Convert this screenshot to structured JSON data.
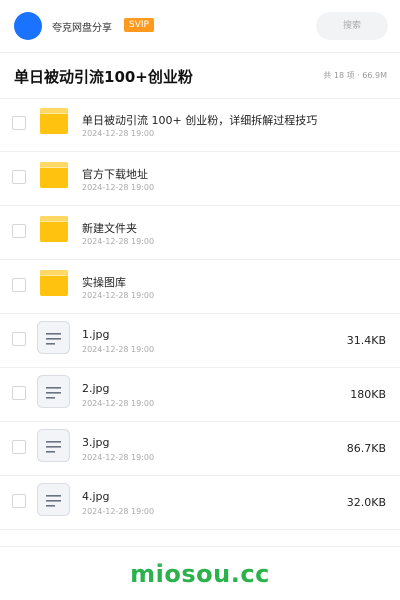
{
  "header": {
    "share_name": "夸克网盘分享",
    "badge": "SVIP",
    "search_placeholder": "搜索",
    "accent_color": "#1a73ff",
    "badge_color": "#ff9a1f"
  },
  "folder": {
    "title": "单日被动引流100+创业粉",
    "meta": "共 18 项 · 66.9M"
  },
  "files": [
    {
      "name": "单日被动引流 100+ 创业粉，详细拆解过程技巧",
      "date": "2024-12-28 19:00",
      "type": "folder",
      "size": ""
    },
    {
      "name": "官方下载地址",
      "date": "2024-12-28 19:00",
      "type": "folder",
      "size": ""
    },
    {
      "name": "新建文件夹",
      "date": "2024-12-28 19:00",
      "type": "folder",
      "size": ""
    },
    {
      "name": "实操图库",
      "date": "2024-12-28 19:00",
      "type": "folder",
      "size": ""
    },
    {
      "name": "1.jpg",
      "date": "2024-12-28 19:00",
      "type": "file",
      "size": "31.4KB"
    },
    {
      "name": "2.jpg",
      "date": "2024-12-28 19:00",
      "type": "file",
      "size": "180KB"
    },
    {
      "name": "3.jpg",
      "date": "2024-12-28 19:00",
      "type": "file",
      "size": "86.7KB"
    },
    {
      "name": "4.jpg",
      "date": "2024-12-28 19:00",
      "type": "file",
      "size": "32.0KB"
    }
  ],
  "footer": {
    "watermark": "miosou.cc",
    "watermark_color": "#2bb24c"
  }
}
